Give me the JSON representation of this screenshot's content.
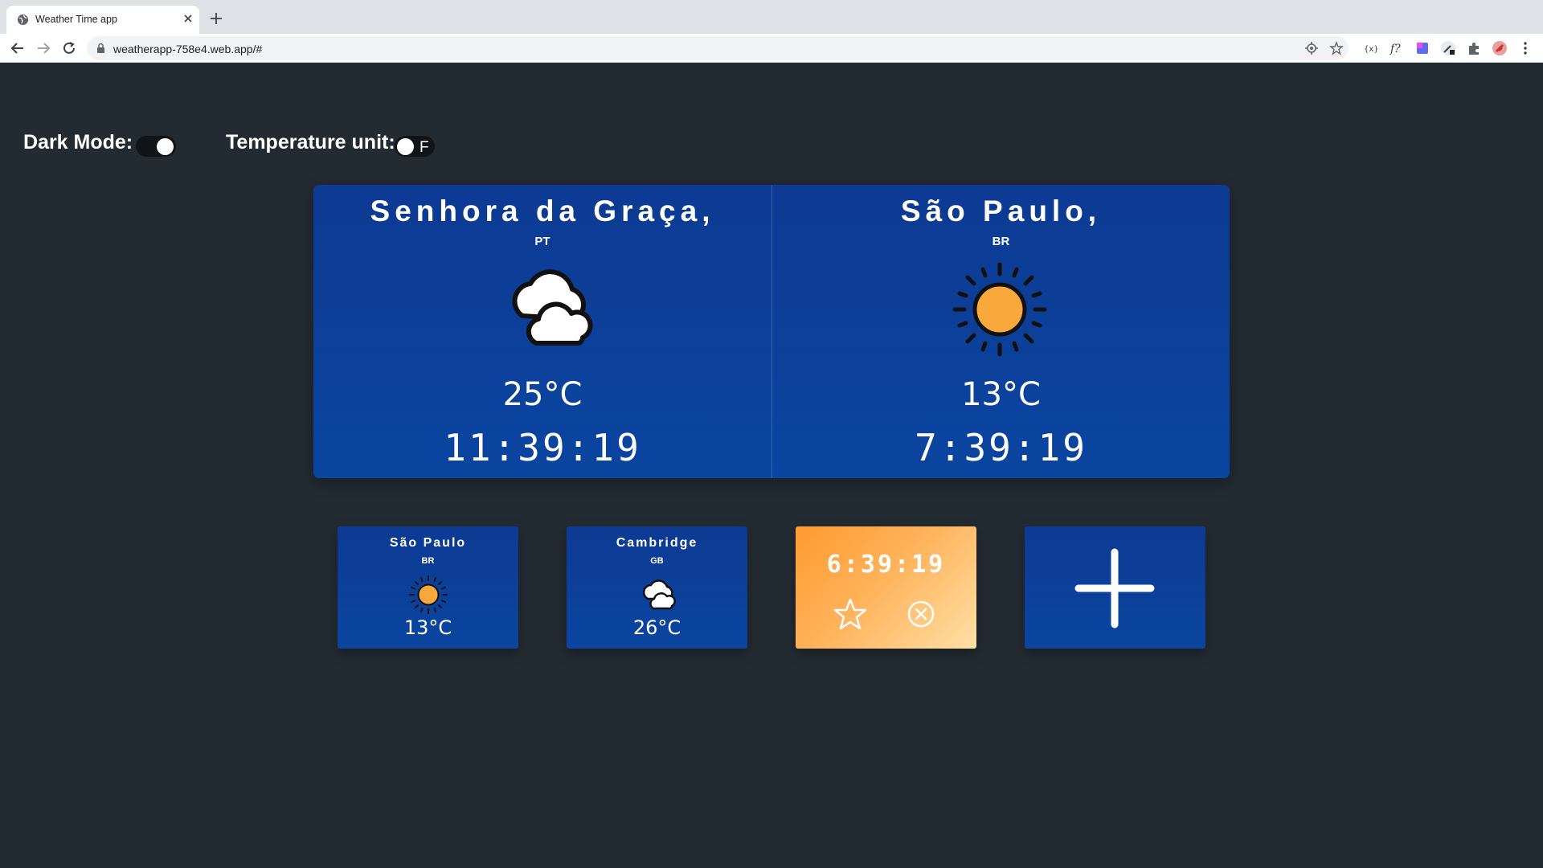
{
  "browser": {
    "tab_title": "Weather Time app",
    "url": "weatherapp-758e4.web.app/#"
  },
  "controls": {
    "dark_mode_label": "Dark Mode:",
    "dark_mode_on": true,
    "temp_unit_label": "Temperature unit:",
    "temp_unit_toggle_text": "F",
    "temp_unit_on": false
  },
  "main_cards": [
    {
      "city": "Senhora da Graça,",
      "country": "PT",
      "icon": "cloudy-icon",
      "temperature": "25°C",
      "time": "11:39:19"
    },
    {
      "city": "São Paulo,",
      "country": "BR",
      "icon": "sun-icon",
      "temperature": "13°C",
      "time": "7:39:19"
    }
  ],
  "mini_cards": [
    {
      "city": "São Paulo",
      "country": "BR",
      "icon": "sun-icon",
      "temperature": "13°C"
    },
    {
      "city": "Cambridge",
      "country": "GB",
      "icon": "cloudy-icon",
      "temperature": "26°C"
    }
  ],
  "clock_card": {
    "time": "6:39:19",
    "icons": [
      "star-icon",
      "remove-icon"
    ]
  },
  "add_card": {
    "icon": "plus-icon"
  },
  "colors": {
    "background": "#232b32",
    "card_blue": "#0a45a0",
    "sun_orange": "#f9a93b",
    "clock_card_orange": "#ff9a2e"
  }
}
